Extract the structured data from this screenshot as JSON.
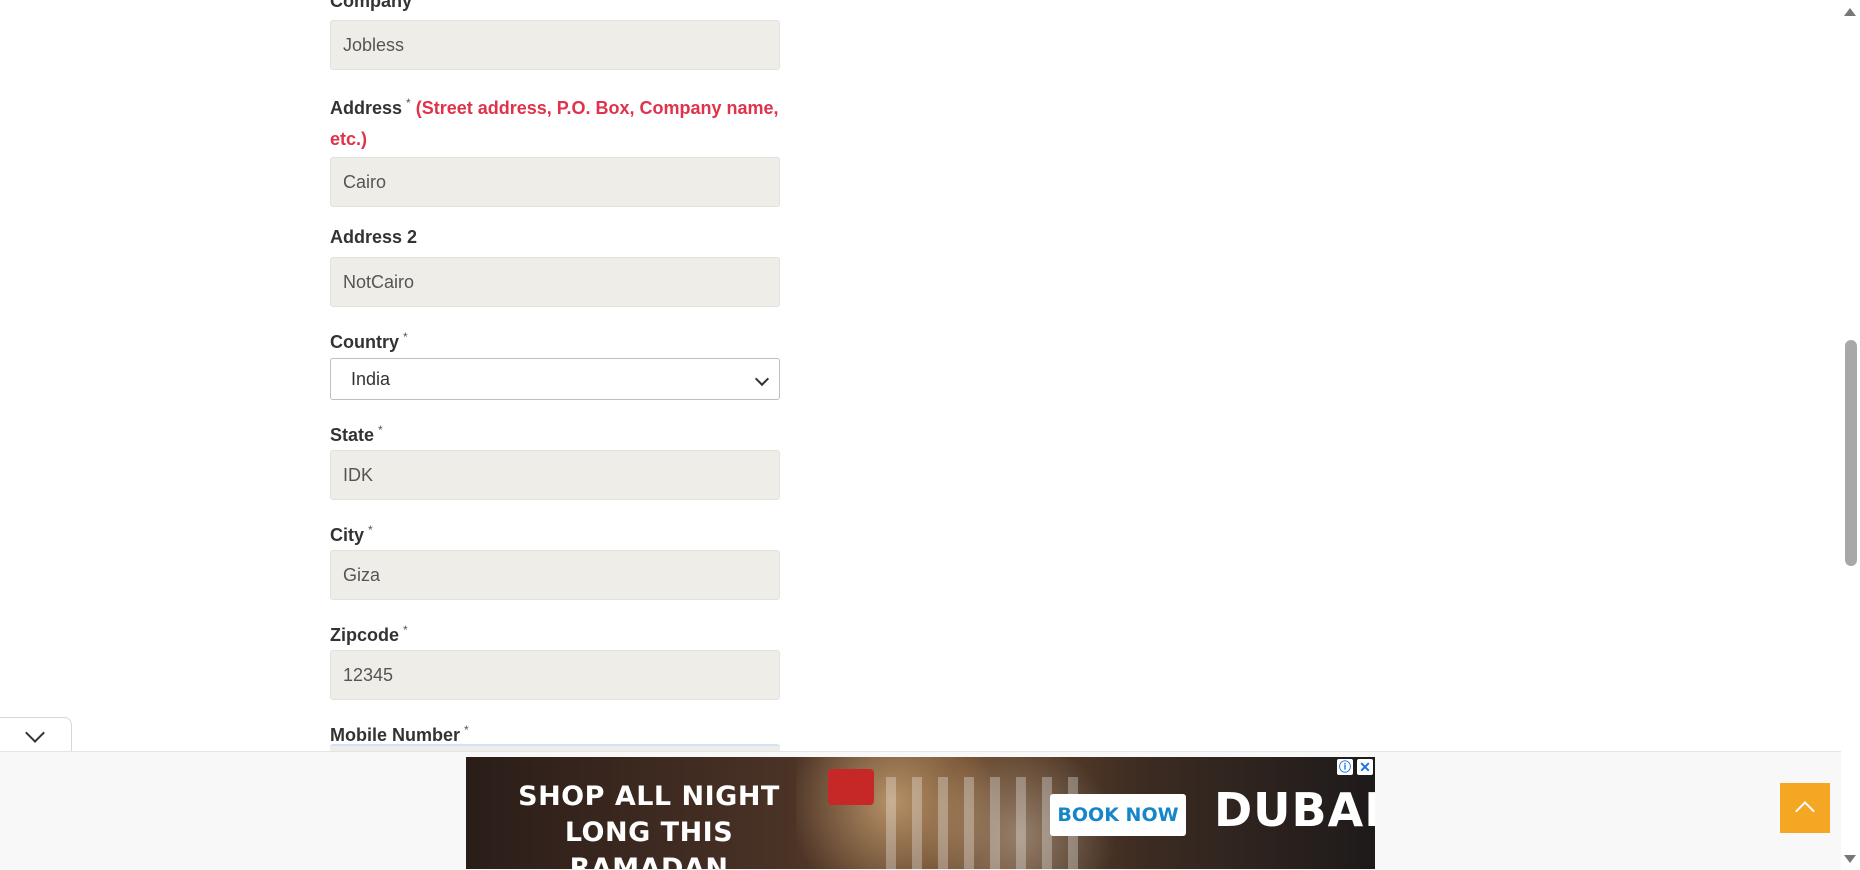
{
  "form": {
    "company": {
      "label": "Company",
      "value": "Jobless"
    },
    "address": {
      "label": "Address",
      "required": "*",
      "hint": "(Street address, P.O. Box, Company name, etc.)",
      "value": "Cairo"
    },
    "address2": {
      "label": "Address 2",
      "value": "NotCairo"
    },
    "country": {
      "label": "Country",
      "required": "*",
      "selected": "India"
    },
    "state": {
      "label": "State",
      "required": "*",
      "value": "IDK"
    },
    "city": {
      "label": "City",
      "required": "*",
      "value": "Giza"
    },
    "zipcode": {
      "label": "Zipcode",
      "required": "*",
      "value": "12345"
    },
    "mobile": {
      "label": "Mobile Number",
      "required": "*"
    }
  },
  "ad": {
    "headline_line1": "SHOP ALL NIGHT",
    "headline_line2": "LONG THIS RAMADAN",
    "cta": "BOOK NOW",
    "brand": "DUBAI",
    "info_glyph": "ⓘ",
    "close_glyph": "✕"
  },
  "icons": {
    "collapse": "chevron-down-icon",
    "back_to_top": "chevron-up-icon"
  },
  "colors": {
    "hint_red": "#e0324a",
    "field_bg": "#efede8",
    "top_button": "#f5a623"
  }
}
